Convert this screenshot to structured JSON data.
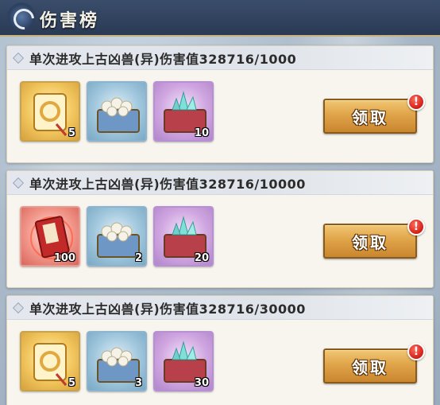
{
  "header": {
    "title": "伤害榜"
  },
  "cards": [
    {
      "title": "单次进攻上古凶兽(异)伤害值328716/1000",
      "items": [
        {
          "icon": "scroll-icon",
          "color": "gold",
          "count": "5"
        },
        {
          "icon": "pearl-chest-icon",
          "color": "blue",
          "count": ""
        },
        {
          "icon": "jade-chest-icon",
          "color": "purple",
          "count": "10"
        }
      ],
      "button": "领取",
      "badge": "!"
    },
    {
      "title": "单次进攻上古凶兽(异)伤害值328716/10000",
      "items": [
        {
          "icon": "red-book-icon",
          "color": "red",
          "count": "100"
        },
        {
          "icon": "pearl-chest-icon",
          "color": "blue",
          "count": "2"
        },
        {
          "icon": "jade-chest-icon",
          "color": "purple",
          "count": "20"
        }
      ],
      "button": "领取",
      "badge": "!"
    },
    {
      "title": "单次进攻上古凶兽(异)伤害值328716/30000",
      "items": [
        {
          "icon": "scroll-icon",
          "color": "gold",
          "count": "5"
        },
        {
          "icon": "pearl-chest-icon",
          "color": "blue",
          "count": "3"
        },
        {
          "icon": "jade-chest-icon",
          "color": "purple",
          "count": "30"
        }
      ],
      "button": "领取",
      "badge": "!"
    }
  ]
}
